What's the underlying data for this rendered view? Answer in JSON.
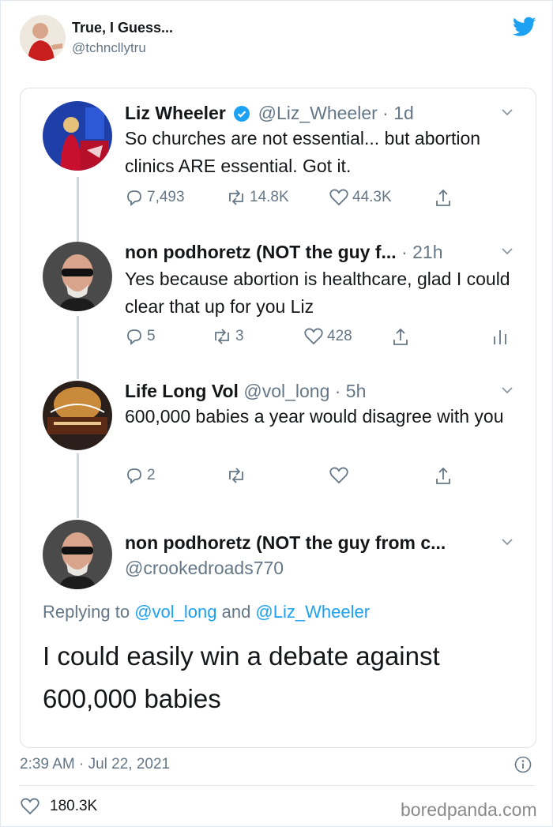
{
  "post": {
    "author_name": "True, I Guess...",
    "author_handle": "@tchncllytru",
    "date": "2:39 AM · Jul 22, 2021",
    "likes": "180.3K"
  },
  "thread": [
    {
      "name": "Liz Wheeler",
      "handle": "@Liz_Wheeler · 1d",
      "verified": true,
      "text": "So churches are not essential... but abortion clinics ARE essential. Got it.",
      "replies": "7,493",
      "retweets": "14.8K",
      "likes": "44.3K"
    },
    {
      "name": "non podhoretz (NOT the guy f...",
      "handle": " · 21h",
      "text": "Yes because abortion is healthcare, glad I could clear that up for you Liz",
      "replies": "5",
      "retweets": "3",
      "likes": "428"
    },
    {
      "name": "Life Long Vol",
      "handle": "@vol_long · 5h",
      "text": "600,000 babies a year would disagree with you",
      "replies": "2",
      "retweets": "",
      "likes": ""
    },
    {
      "name": "non podhoretz (NOT the guy from c...",
      "handle": "@crookedroads770"
    }
  ],
  "reply": {
    "prefix": "Replying to ",
    "mention1": "@vol_long",
    "conj": " and ",
    "mention2": "@Liz_Wheeler",
    "text": "I could easily win a debate against 600,000 babies"
  },
  "watermark": "boredpanda.com",
  "colors": {
    "twitter_blue": "#1da1f2",
    "gray": "#657786",
    "verified": "#1da1f2"
  },
  "icons": [
    "twitter-bird-icon",
    "reply-icon",
    "retweet-icon",
    "like-icon",
    "share-icon",
    "analytics-icon",
    "chevron-down-icon",
    "info-icon",
    "verified-badge-icon"
  ]
}
